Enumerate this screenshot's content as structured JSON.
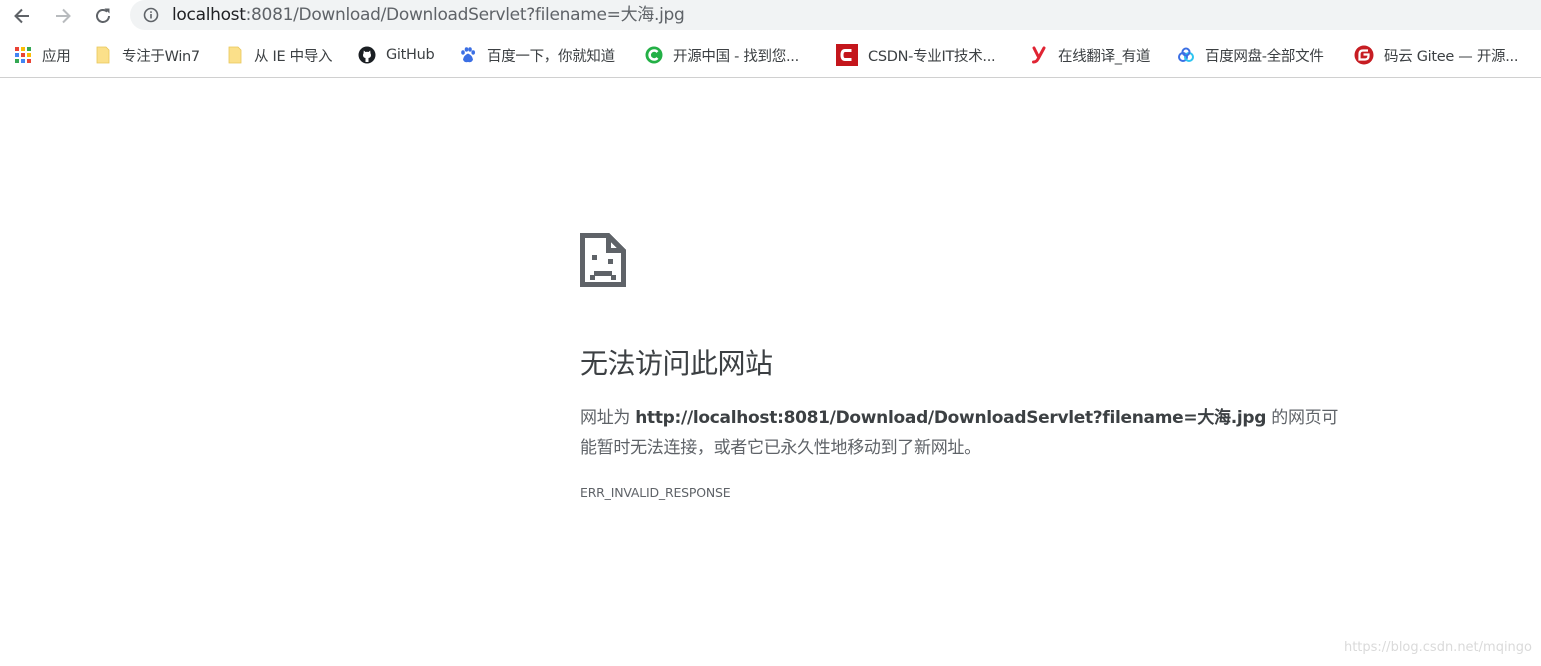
{
  "toolbar": {
    "back_icon": "back-arrow-icon",
    "forward_icon": "forward-arrow-icon",
    "reload_icon": "reload-icon",
    "site_info_icon": "info-icon",
    "url_host": "localhost",
    "url_path": ":8081/Download/DownloadServlet?filename=大海.jpg"
  },
  "bookmarks": [
    {
      "label": "应用",
      "icon": "apps-grid-icon"
    },
    {
      "label": "专注于Win7",
      "icon": "folder-icon"
    },
    {
      "label": "从 IE 中导入",
      "icon": "folder-icon"
    },
    {
      "label": "GitHub",
      "icon": "github-icon"
    },
    {
      "label": "百度一下，你就知道",
      "icon": "baidu-paw-icon"
    },
    {
      "label": "开源中国 - 找到您...",
      "icon": "oschina-icon"
    },
    {
      "label": "CSDN-专业IT技术...",
      "icon": "csdn-icon"
    },
    {
      "label": "在线翻译_有道",
      "icon": "youdao-icon"
    },
    {
      "label": "百度网盘-全部文件",
      "icon": "baidu-netdisk-icon"
    },
    {
      "label": "码云 Gitee — 开源...",
      "icon": "gitee-icon"
    }
  ],
  "error": {
    "icon": "sad-page-icon",
    "title": "无法访问此网站",
    "desc_prefix": "网址为 ",
    "desc_url": "http://localhost:8081/Download/DownloadServlet?filename=大海.jpg",
    "desc_suffix": " 的网页可能暂时无法连接，或者它已永久性地移动到了新网址。",
    "code": "ERR_INVALID_RESPONSE"
  },
  "watermark": "https://blog.csdn.net/mqingo",
  "colors": {
    "omnibox_bg": "#f1f3f4",
    "text_primary": "#3c4043",
    "text_secondary": "#5f6368",
    "csdn_red": "#c4161c",
    "gitee_red": "#c71d23",
    "youdao_red": "#e02433",
    "oschina_green": "#23b046",
    "baidu_blue": "#3b6fe4",
    "folder_yellow": "#fbe08a"
  }
}
